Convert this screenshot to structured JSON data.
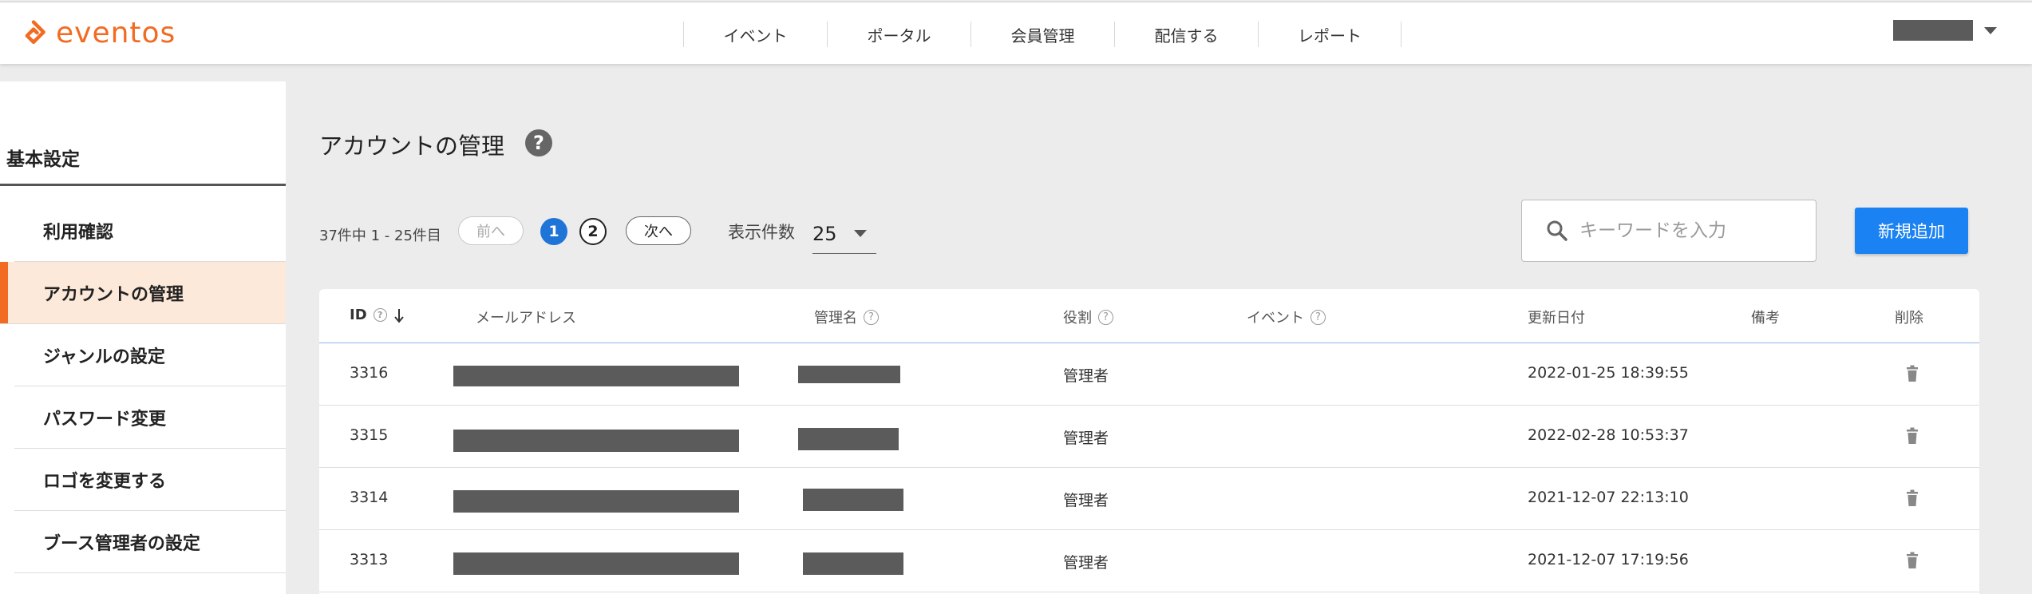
{
  "header": {
    "logo_text": "eventos",
    "brand_color": "#f26b22",
    "nav": [
      "イベント",
      "ポータル",
      "会員管理",
      "配信する",
      "レポート"
    ]
  },
  "sidebar": {
    "section_title": "基本設定",
    "items": [
      {
        "label": "利用確認",
        "active": false
      },
      {
        "label": "アカウントの管理",
        "active": true
      },
      {
        "label": "ジャンルの設定",
        "active": false
      },
      {
        "label": "パスワード変更",
        "active": false
      },
      {
        "label": "ロゴを変更する",
        "active": false
      },
      {
        "label": "ブース管理者の設定",
        "active": false
      }
    ]
  },
  "main": {
    "title": "アカウントの管理",
    "help_icon": "?",
    "pager": {
      "range_text": "37件中 1 - 25件目",
      "prev_label": "前へ",
      "next_label": "次へ",
      "pages": [
        "1",
        "2"
      ],
      "current_page": "1"
    },
    "per_page": {
      "label": "表示件数",
      "value": "25"
    },
    "search": {
      "placeholder": "キーワードを入力"
    },
    "add_button": "新規追加",
    "accent_color": "#1a82f2"
  },
  "table": {
    "columns": [
      "ID",
      "メールアドレス",
      "管理名",
      "役割",
      "イベント",
      "更新日付",
      "備考",
      "削除"
    ],
    "rows": [
      {
        "id": "3316",
        "role": "管理者",
        "updated": "2022-01-25 18:39:55"
      },
      {
        "id": "3315",
        "role": "管理者",
        "updated": "2022-02-28 10:53:37"
      },
      {
        "id": "3314",
        "role": "管理者",
        "updated": "2021-12-07 22:13:10"
      },
      {
        "id": "3313",
        "role": "管理者",
        "updated": "2021-12-07 17:19:56"
      }
    ]
  }
}
